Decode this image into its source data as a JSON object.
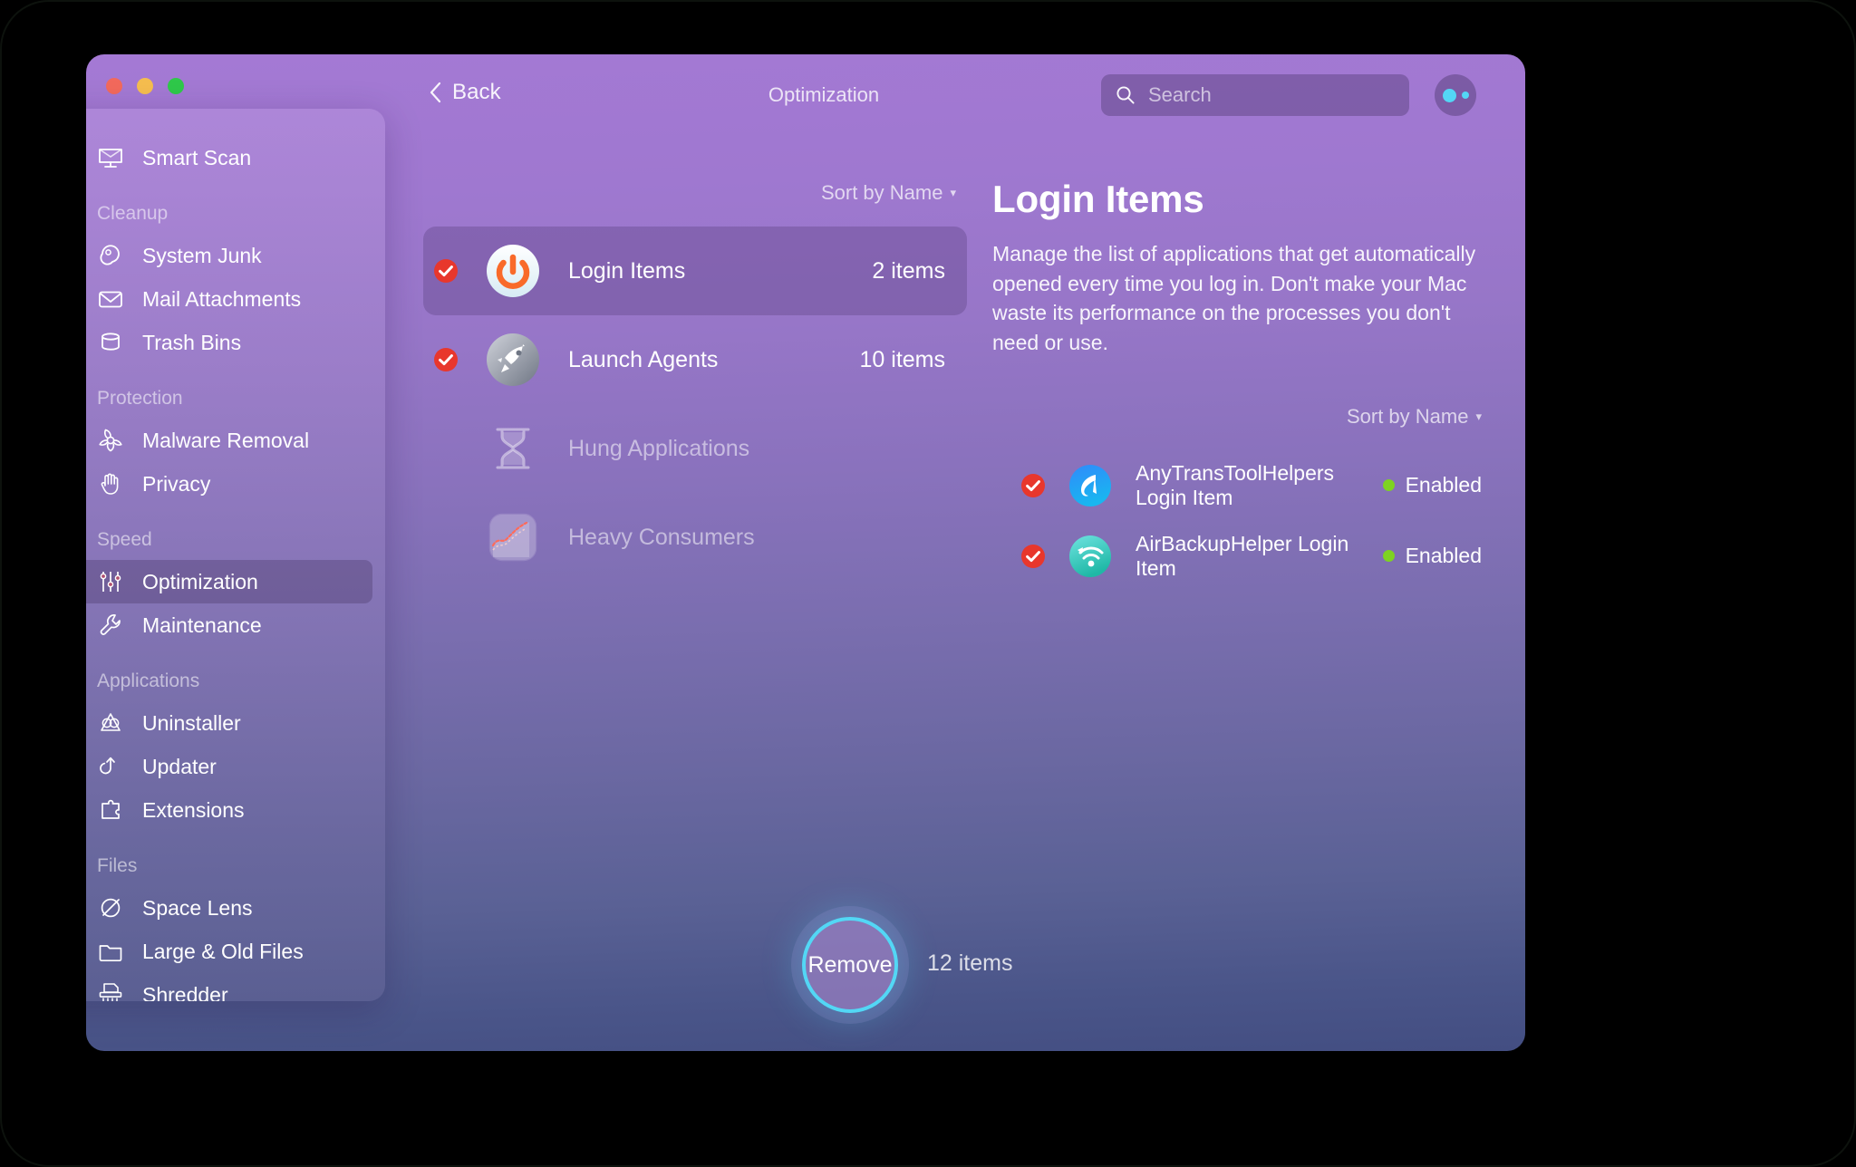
{
  "window": {
    "traffic_lights": [
      "close",
      "minimize",
      "zoom"
    ]
  },
  "toolbar": {
    "back_label": "Back",
    "title": "Optimization",
    "search_placeholder": "Search",
    "search_value": "",
    "assistant_icon": "assistant-dots-icon"
  },
  "sidebar": {
    "top_item": {
      "label": "Smart Scan",
      "icon": "monitor-scan-icon"
    },
    "groups": [
      {
        "label": "Cleanup",
        "items": [
          {
            "label": "System Junk",
            "icon": "system-junk-icon"
          },
          {
            "label": "Mail Attachments",
            "icon": "envelope-icon"
          },
          {
            "label": "Trash Bins",
            "icon": "trash-bin-icon"
          }
        ]
      },
      {
        "label": "Protection",
        "items": [
          {
            "label": "Malware Removal",
            "icon": "biohazard-icon"
          },
          {
            "label": "Privacy",
            "icon": "hand-icon"
          }
        ]
      },
      {
        "label": "Speed",
        "items": [
          {
            "label": "Optimization",
            "icon": "sliders-icon",
            "active": true
          },
          {
            "label": "Maintenance",
            "icon": "wrench-icon"
          }
        ]
      },
      {
        "label": "Applications",
        "items": [
          {
            "label": "Uninstaller",
            "icon": "app-uninstall-icon"
          },
          {
            "label": "Updater",
            "icon": "refresh-arrow-icon"
          },
          {
            "label": "Extensions",
            "icon": "puzzle-piece-icon"
          }
        ]
      },
      {
        "label": "Files",
        "items": [
          {
            "label": "Space Lens",
            "icon": "space-lens-icon"
          },
          {
            "label": "Large & Old Files",
            "icon": "folder-icon"
          },
          {
            "label": "Shredder",
            "icon": "shredder-icon"
          }
        ]
      }
    ]
  },
  "middle": {
    "sort_label": "Sort by Name",
    "rows": [
      {
        "name": "Login Items",
        "count": "2 items",
        "icon": "power-button-icon",
        "checked": true,
        "selected": true,
        "dim": false
      },
      {
        "name": "Launch Agents",
        "count": "10 items",
        "icon": "rocket-icon",
        "checked": true,
        "selected": false,
        "dim": false
      },
      {
        "name": "Hung Applications",
        "count": "",
        "icon": "hourglass-icon",
        "checked": false,
        "selected": false,
        "dim": true
      },
      {
        "name": "Heavy Consumers",
        "count": "",
        "icon": "graph-chart-icon",
        "checked": false,
        "selected": false,
        "dim": true
      }
    ]
  },
  "detail": {
    "title": "Login Items",
    "description": "Manage the list of applications that get automatically opened every time you log in. Don't make your Mac waste its performance on the processes you don't need or use.",
    "sort_label": "Sort by Name",
    "rows": [
      {
        "name": "AnyTransToolHelpers Login Item",
        "status": "Enabled",
        "icon": "anytrans-app-icon",
        "checked": true
      },
      {
        "name": "AirBackupHelper Login Item",
        "status": "Enabled",
        "icon": "airbackup-app-icon",
        "checked": true
      }
    ]
  },
  "action": {
    "button_label": "Remove",
    "items_count": "12 items"
  },
  "colors": {
    "accent_cyan": "#53d7f5",
    "check_red": "#e8372c",
    "status_green": "#7ed321",
    "window_top": "#a479d4",
    "window_bottom": "#434e82"
  }
}
